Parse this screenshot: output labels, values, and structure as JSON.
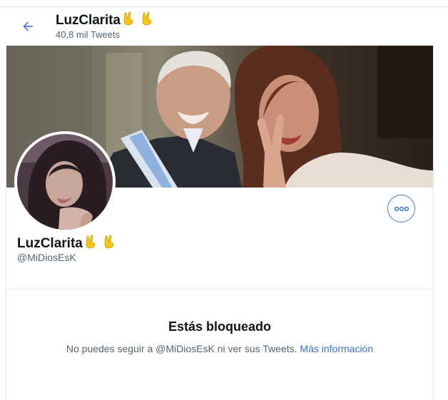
{
  "header": {
    "back_icon": "arrow-left-icon",
    "title": "LuzClarita",
    "title_emojis": [
      "victory-hand-icon",
      "victory-hand-icon"
    ],
    "tweet_count": "40,8 mil Tweets"
  },
  "profile": {
    "display_name": "LuzClarita",
    "name_emojis": [
      "victory-hand-icon",
      "victory-hand-icon"
    ],
    "handle": "@MiDiosEsK",
    "more_icon": "more-horizontal-icon"
  },
  "blocked": {
    "title": "Estás bloqueado",
    "message": "No puedes seguir a @MiDiosEsK ni ver sus Tweets. ",
    "link": "Más información"
  },
  "colors": {
    "accent": "#3b6fd4",
    "border": "#e6ecf0",
    "secondary_text": "#536471",
    "emoji_yellow": "#f5c518"
  }
}
